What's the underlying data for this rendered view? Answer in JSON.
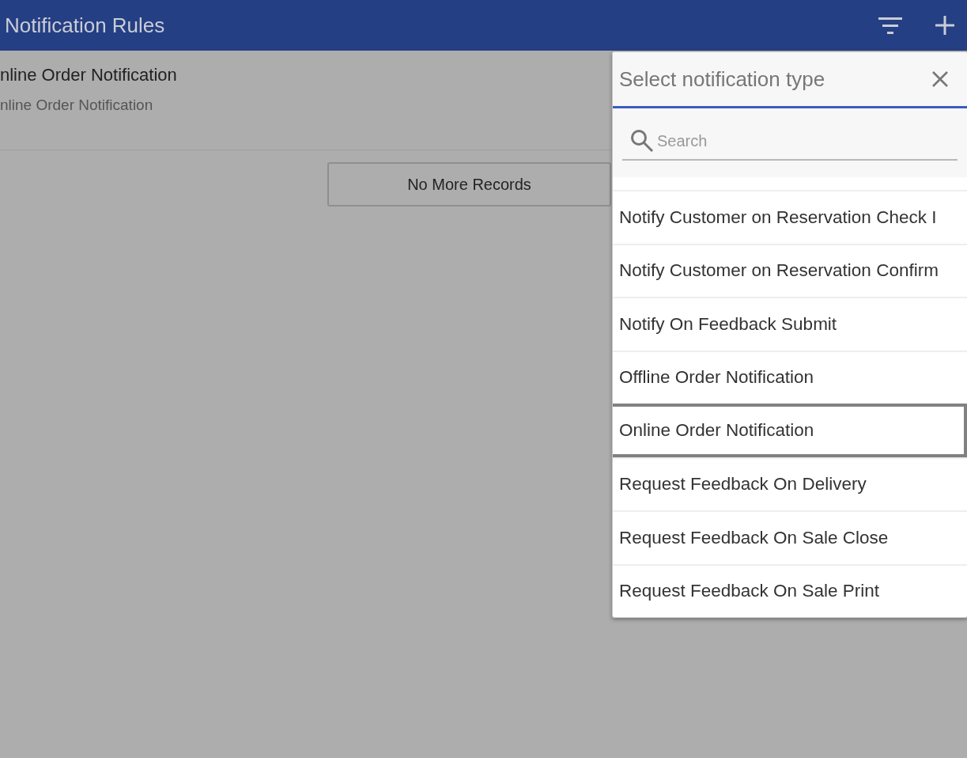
{
  "app_bar": {
    "title": "Notification Rules"
  },
  "rules": [
    {
      "title": "nline Order Notification",
      "subtitle": "nline Order Notification"
    }
  ],
  "load_more": {
    "label": "No More Records"
  },
  "type_picker": {
    "title": "Select notification type",
    "search": {
      "placeholder": "Search"
    },
    "items": [
      {
        "label": "Notify Customer on Reservation Check I",
        "selected": false
      },
      {
        "label": "Notify Customer on Reservation Confirm",
        "selected": false
      },
      {
        "label": "Notify On Feedback Submit",
        "selected": false
      },
      {
        "label": "Offline Order Notification",
        "selected": false
      },
      {
        "label": "Online Order Notification",
        "selected": true
      },
      {
        "label": "Request Feedback On Delivery",
        "selected": false
      },
      {
        "label": "Request Feedback On Sale Close",
        "selected": false
      },
      {
        "label": "Request Feedback On Sale Print",
        "selected": false
      }
    ]
  }
}
